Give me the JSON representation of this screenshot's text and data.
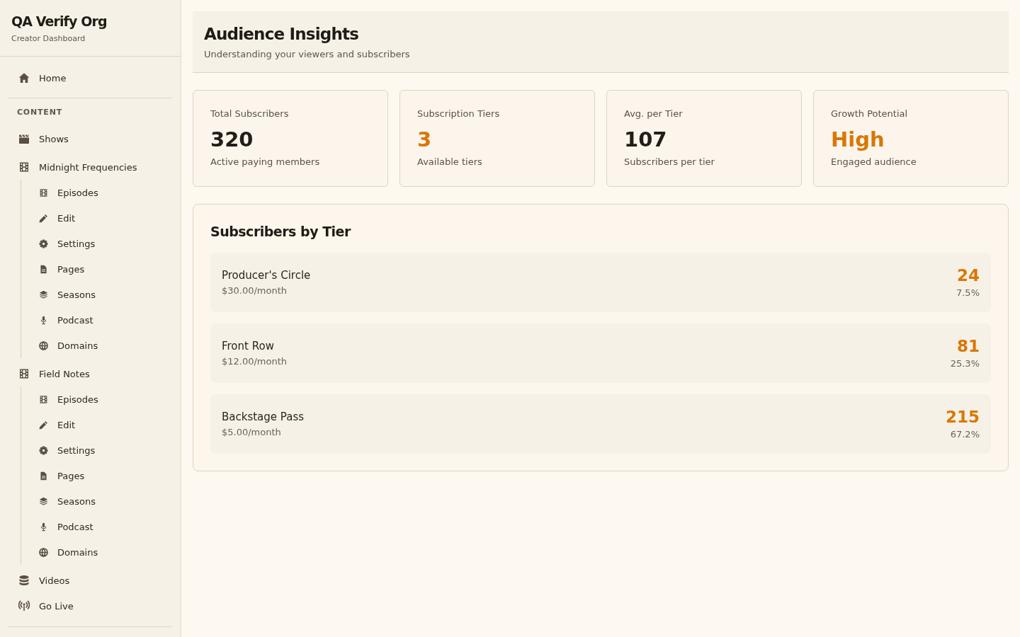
{
  "sidebar": {
    "title": "QA Verify Org",
    "subtitle": "Creator Dashboard",
    "home": {
      "label": "Home"
    },
    "section_label": "CONTENT",
    "items": [
      {
        "label": "Shows"
      },
      {
        "label": "Midnight Frequencies",
        "children": [
          {
            "label": "Episodes"
          },
          {
            "label": "Edit"
          },
          {
            "label": "Settings"
          },
          {
            "label": "Pages"
          },
          {
            "label": "Seasons"
          },
          {
            "label": "Podcast"
          },
          {
            "label": "Domains"
          }
        ]
      },
      {
        "label": "Field Notes",
        "children": [
          {
            "label": "Episodes"
          },
          {
            "label": "Edit"
          },
          {
            "label": "Settings"
          },
          {
            "label": "Pages"
          },
          {
            "label": "Seasons"
          },
          {
            "label": "Podcast"
          },
          {
            "label": "Domains"
          }
        ]
      },
      {
        "label": "Videos"
      },
      {
        "label": "Go Live"
      }
    ]
  },
  "header": {
    "title": "Audience Insights",
    "subtitle": "Understanding your viewers and subscribers"
  },
  "stats": [
    {
      "label": "Total Subscribers",
      "value": "320",
      "caption": "Active paying members",
      "color": "#231e1a"
    },
    {
      "label": "Subscription Tiers",
      "value": "3",
      "caption": "Available tiers",
      "color": "#d97706"
    },
    {
      "label": "Avg. per Tier",
      "value": "107",
      "caption": "Subscribers per tier",
      "color": "#231e1a"
    },
    {
      "label": "Growth Potential",
      "value": "High",
      "caption": "Engaged audience",
      "color": "#d97706"
    }
  ],
  "tiers_panel": {
    "title": "Subscribers by Tier",
    "tiers": [
      {
        "name": "Producer's Circle",
        "price": "$30.00/month",
        "count": "24",
        "share": "7.5%"
      },
      {
        "name": "Front Row",
        "price": "$12.00/month",
        "count": "81",
        "share": "25.3%"
      },
      {
        "name": "Backstage Pass",
        "price": "$5.00/month",
        "count": "215",
        "share": "67.2%"
      }
    ]
  }
}
